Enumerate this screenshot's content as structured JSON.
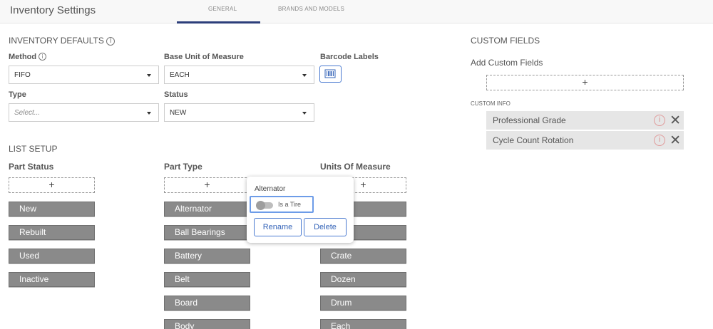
{
  "header": {
    "title": "Inventory Settings",
    "tabs": [
      {
        "label": "GENERAL",
        "active": true
      },
      {
        "label": "BRANDS AND MODELS",
        "active": false
      }
    ]
  },
  "inventory_defaults": {
    "title": "INVENTORY DEFAULTS",
    "method": {
      "label": "Method",
      "value": "FIFO"
    },
    "base_unit": {
      "label": "Base Unit of Measure",
      "value": "EACH"
    },
    "barcode": {
      "label": "Barcode Labels",
      "icon": "barcode-icon"
    },
    "type": {
      "label": "Type",
      "placeholder": "Select..."
    },
    "status": {
      "label": "Status",
      "value": "NEW"
    }
  },
  "list_setup": {
    "title": "LIST SETUP",
    "part_status": {
      "label": "Part Status",
      "items": [
        "New",
        "Rebuilt",
        "Used",
        "Inactive"
      ]
    },
    "part_type": {
      "label": "Part Type",
      "items": [
        "Alternator",
        "Ball Bearings",
        "Battery",
        "Belt",
        "Board",
        "Body"
      ]
    },
    "units": {
      "label": "Units Of Measure",
      "items": [
        "",
        "",
        "Crate",
        "Dozen",
        "Drum",
        "Each"
      ]
    },
    "add_symbol": "+"
  },
  "popover": {
    "title": "Alternator",
    "toggle_label": "Is a Tire",
    "toggle_on": false,
    "rename_label": "Rename",
    "delete_label": "Delete"
  },
  "custom_fields": {
    "title": "CUSTOM FIELDS",
    "add_label": "Add Custom Fields",
    "add_symbol": "+",
    "info_label": "CUSTOM INFO",
    "items": [
      "Professional Grade",
      "Cycle Count Rotation"
    ],
    "info_glyph": "i",
    "remove_glyph": "✕"
  },
  "colors": {
    "accent": "#2c3e7a",
    "button_blue": "#4a7ad0",
    "chip_gray": "#8a8a8a",
    "row_gray": "#e6e6e6"
  }
}
